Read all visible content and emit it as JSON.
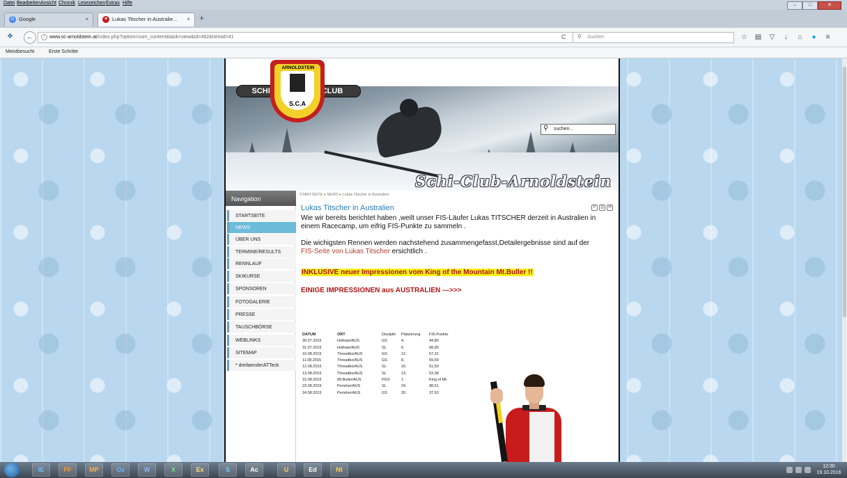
{
  "menubar": {
    "items": [
      "Datei",
      "Bearbeiten",
      "Ansicht",
      "Chronik",
      "Lesezeichen",
      "Extras",
      "Hilfe"
    ]
  },
  "tabs": [
    {
      "label": "Google",
      "icon": "google-icon"
    },
    {
      "label": "Lukas Titscher in Australie...",
      "icon": "club-favicon"
    }
  ],
  "navbar": {
    "url_host": "www.sc-arnoldstein.at",
    "url_path": "/index.php?option=com_content&task=view&id=492&Itemid=41",
    "search_placeholder": "Suchen"
  },
  "bookmarks": [
    "Meistbesucht",
    "Erste Schritte"
  ],
  "header": {
    "logo_arc": "ARNOLDSTEIN",
    "logo_left": "SCHI -",
    "logo_right": "CLUB",
    "logo_bottom": "S.C.A",
    "club_name": "Schi-Club-Arnoldstein",
    "search_value": "suchen..."
  },
  "sidebar": {
    "heading": "Navigation",
    "items": [
      {
        "label": "STARTSEITE",
        "active": false
      },
      {
        "label": "NEWS",
        "active": true
      },
      {
        "label": "ÜBER UNS",
        "active": false
      },
      {
        "label": "TERMINE/RESULTS",
        "active": false
      },
      {
        "label": "RENNLAUF",
        "active": false
      },
      {
        "label": "SKIKURSE",
        "active": false
      },
      {
        "label": "SPONSOREN",
        "active": false
      },
      {
        "label": "FOTOGALERIE",
        "active": false
      },
      {
        "label": "PRESSE",
        "active": false
      },
      {
        "label": "TAUSCHBÖRSE",
        "active": false
      },
      {
        "label": "WEBLINKS",
        "active": false
      },
      {
        "label": "SITEMAP",
        "active": false
      },
      {
        "label": "* dreilaenderATTeck",
        "active": false
      }
    ]
  },
  "content": {
    "breadcrumb": [
      "STARTSEITE",
      "NEWS",
      "Lukas Titscher in Australien"
    ],
    "title": "Lukas Titscher in Australien",
    "para1": "Wie wir bereits berichtet haben ,weilt unser FIS-Läufer Lukas TITSCHER derzeit in Australien in einem Racecamp, um eifrig FIS-Punkte zu sammeln .",
    "para2_start": "Die wichigsten Rennen werden nachstehend zusammengefasst,Detailergebnisse sind auf der",
    "para2_link": "FIS-Seite von Lukas Titscher",
    "para2_end": "ersichtlich .",
    "highlight": "INKLUSIVE neuer Impressionen vom King of the Mountain Mt.Buller !!",
    "impressions_link": "EINIGE IMPRESSIONEN aus AUSTRALIEN --->>>"
  },
  "results": {
    "headers": [
      "DATUM",
      "ORT",
      "Disziplin",
      "Platzierung",
      "FIS-Punkte"
    ],
    "rows": [
      [
        "30.07.2015",
        "Hotham/AUS",
        "GS",
        "4.",
        "44,80"
      ],
      [
        "31.07.2015",
        "Hotham/AUS",
        "SL",
        "6.",
        "68,90"
      ],
      [
        "10.08.2015",
        "Threadbo/AUS",
        "GS",
        "12.",
        "57,31"
      ],
      [
        "11.08.2015",
        "Threadbo/AUS",
        "GS",
        "8.",
        "59,59"
      ],
      [
        "12.08.2015",
        "Threadbo/AUS",
        "SL",
        "10.",
        "61,50"
      ],
      [
        "13.08.2015",
        "Threadbo/AUS",
        "SL",
        "13.",
        "53,38"
      ],
      [
        "15.08.2015",
        "Mt.Buller/AUS",
        "PGS",
        "1.",
        "King of Mt."
      ],
      [
        "23.08.2015",
        "Perisher/AUS",
        "SL",
        "24.",
        "98,61"
      ],
      [
        "24.08.2015",
        "Perisher/AUS",
        "GS",
        "20.",
        "37,52"
      ]
    ]
  },
  "taskbar": {
    "apps": [
      "IE",
      "FF",
      "MP",
      "Oz",
      "W",
      "X",
      "Ex",
      "S",
      "Ac",
      "U",
      "Ed",
      "Nt"
    ],
    "time": "12:30",
    "date": "19.10.2016"
  }
}
